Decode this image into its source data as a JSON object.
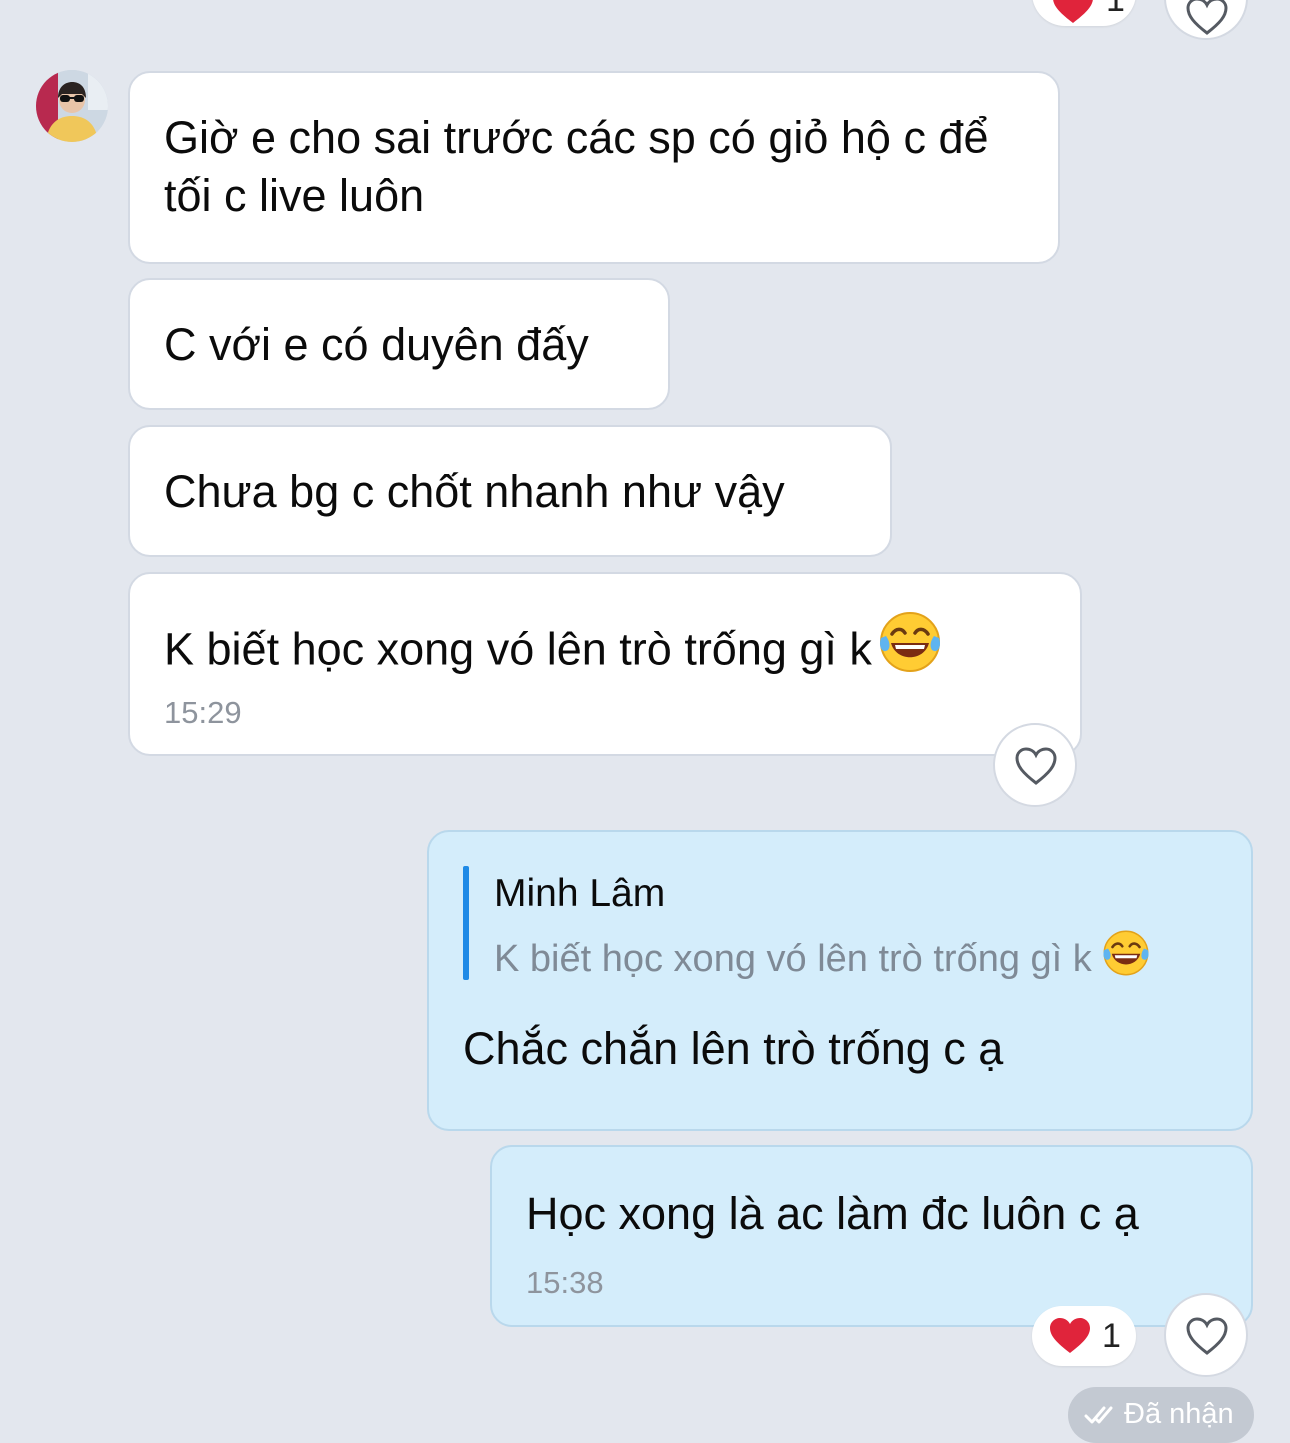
{
  "colors": {
    "background": "#e3e7ee",
    "incoming_bubble": "#ffffff",
    "outgoing_bubble": "#d4edfb",
    "quote_bar": "#1f8ae6",
    "heart": "#e0243b",
    "time_text": "#8e949d"
  },
  "top_reaction": {
    "icon": "red-heart-icon",
    "count": "1"
  },
  "contact": {
    "avatar": "contact-avatar"
  },
  "messages": [
    {
      "text": "Giờ e cho sai trước các sp có giỏ hộ c để tối c live luôn"
    },
    {
      "text": "C với e có duyên đấy"
    },
    {
      "text": "Chưa bg c chốt nhanh như vậy"
    },
    {
      "text": "K biết học xong vó lên trò trống gì k",
      "emoji": "laughing-tears-emoji",
      "time": "15:29"
    }
  ],
  "reply": {
    "quote_name": "Minh Lâm",
    "quote_text": "K biết học xong vó lên trò trống gì k",
    "text": "Chắc chắn lên trò trống c ạ"
  },
  "last_message": {
    "text": "Học xong là ac làm đc luôn c ạ",
    "time": "15:38",
    "reaction_icon": "red-heart-icon",
    "reaction_count": "1",
    "status": "Đã nhận"
  }
}
